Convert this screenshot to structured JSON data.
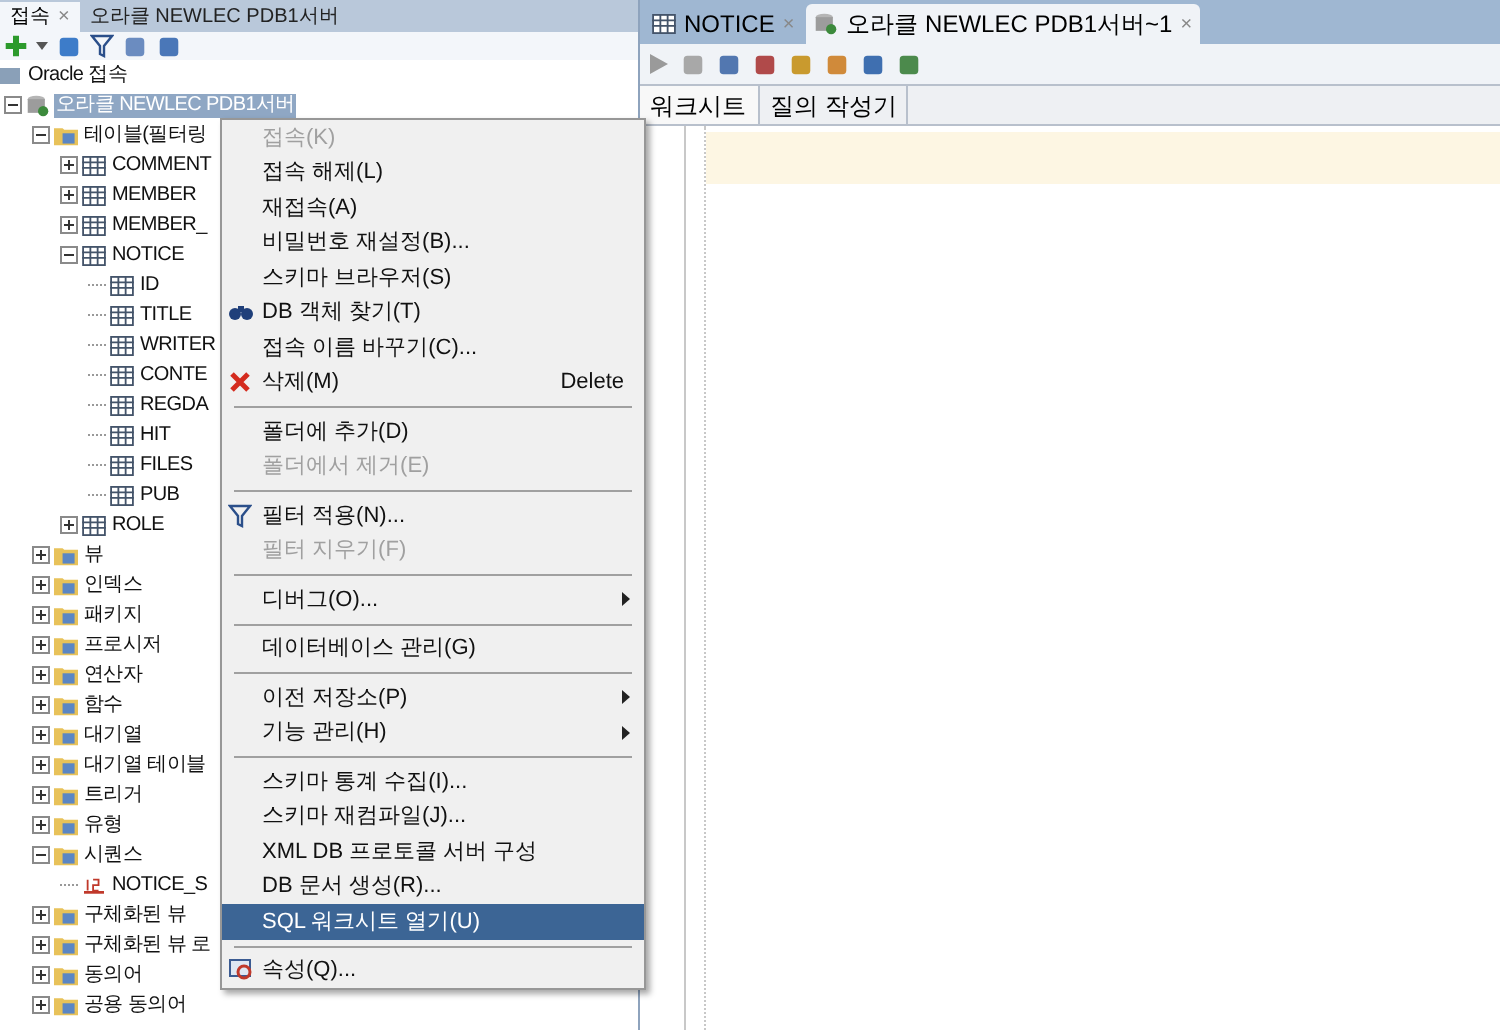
{
  "left_tabs": [
    {
      "label": "접속",
      "selected": true,
      "close": "×"
    },
    {
      "label": "오라클 NEWLEC PDB1서버",
      "selected": false
    }
  ],
  "tree": [
    {
      "label": "Oracle 접속",
      "kind": "root",
      "selected": false,
      "children": [
        {
          "label": "오라클 NEWLEC PDB1서버",
          "kind": "connection",
          "expanded": true,
          "selected": true,
          "children": [
            {
              "label": "테이블(필터링",
              "kind": "folder",
              "expanded": true,
              "selected": false,
              "children": [
                {
                  "label": "COMMENT",
                  "kind": "table",
                  "expanded": false,
                  "selected": false
                },
                {
                  "label": "MEMBER",
                  "kind": "table",
                  "expanded": false,
                  "selected": false
                },
                {
                  "label": "MEMBER_",
                  "kind": "table",
                  "expanded": false,
                  "selected": false
                },
                {
                  "label": "NOTICE",
                  "kind": "table",
                  "expanded": true,
                  "selected": false,
                  "children": [
                    {
                      "label": "ID",
                      "kind": "column",
                      "selected": false
                    },
                    {
                      "label": "TITLE",
                      "kind": "column",
                      "selected": false
                    },
                    {
                      "label": "WRITER",
                      "kind": "column",
                      "selected": false
                    },
                    {
                      "label": "CONTE",
                      "kind": "column",
                      "selected": false
                    },
                    {
                      "label": "REGDA",
                      "kind": "column",
                      "selected": false
                    },
                    {
                      "label": "HIT",
                      "kind": "column",
                      "selected": false
                    },
                    {
                      "label": "FILES",
                      "kind": "column",
                      "selected": false
                    },
                    {
                      "label": "PUB",
                      "kind": "column",
                      "selected": false
                    }
                  ]
                },
                {
                  "label": "ROLE",
                  "kind": "table",
                  "expanded": false,
                  "selected": false
                }
              ]
            },
            {
              "label": "뷰",
              "kind": "folder",
              "expanded": false,
              "selected": false
            },
            {
              "label": "인덱스",
              "kind": "folder",
              "expanded": false,
              "selected": false
            },
            {
              "label": "패키지",
              "kind": "folder",
              "expanded": false,
              "selected": false
            },
            {
              "label": "프로시저",
              "kind": "folder",
              "expanded": false,
              "selected": false
            },
            {
              "label": "연산자",
              "kind": "folder",
              "expanded": false,
              "selected": false
            },
            {
              "label": "함수",
              "kind": "folder",
              "expanded": false,
              "selected": false
            },
            {
              "label": "대기열",
              "kind": "folder",
              "expanded": false,
              "selected": false
            },
            {
              "label": "대기열 테이블",
              "kind": "folder",
              "expanded": false,
              "selected": false
            },
            {
              "label": "트리거",
              "kind": "folder",
              "expanded": false,
              "selected": false
            },
            {
              "label": "유형",
              "kind": "folder",
              "expanded": false,
              "selected": false
            },
            {
              "label": "시퀀스",
              "kind": "folder",
              "expanded": true,
              "selected": false,
              "children": [
                {
                  "label": "NOTICE_S",
                  "kind": "sequence",
                  "selected": false
                }
              ]
            },
            {
              "label": "구체화된 뷰",
              "kind": "folder",
              "expanded": false,
              "selected": false
            },
            {
              "label": "구체화된 뷰 로",
              "kind": "folder",
              "expanded": false,
              "selected": false
            },
            {
              "label": "동의어",
              "kind": "folder",
              "expanded": false,
              "selected": false
            },
            {
              "label": "공용 동의어",
              "kind": "folder",
              "expanded": false,
              "selected": false
            }
          ]
        }
      ]
    }
  ],
  "context_menu": [
    {
      "kind": "item",
      "label": "접속(K)",
      "disabled": true,
      "selected": false
    },
    {
      "kind": "item",
      "label": "접속 해제(L)",
      "disabled": false,
      "selected": false
    },
    {
      "kind": "item",
      "label": "재접속(A)",
      "disabled": false,
      "selected": false
    },
    {
      "kind": "item",
      "label": "비밀번호 재설정(B)...",
      "disabled": false,
      "selected": false
    },
    {
      "kind": "item",
      "label": "스키마 브라우저(S)",
      "disabled": false,
      "selected": false
    },
    {
      "kind": "item",
      "label": "DB 객체 찾기(T)",
      "disabled": false,
      "selected": false
    },
    {
      "kind": "item",
      "label": "접속 이름 바꾸기(C)...",
      "disabled": false,
      "selected": false
    },
    {
      "kind": "item",
      "label": "삭제(M)",
      "disabled": false,
      "selected": false,
      "shortcut": "Delete"
    },
    {
      "kind": "separator"
    },
    {
      "kind": "item",
      "label": "폴더에 추가(D)",
      "disabled": false,
      "selected": false
    },
    {
      "kind": "item",
      "label": "폴더에서 제거(E)",
      "disabled": true,
      "selected": false
    },
    {
      "kind": "separator"
    },
    {
      "kind": "item",
      "label": "필터 적용(N)...",
      "disabled": false,
      "selected": false
    },
    {
      "kind": "item",
      "label": "필터 지우기(F)",
      "disabled": true,
      "selected": false
    },
    {
      "kind": "separator"
    },
    {
      "kind": "item",
      "label": "디버그(O)...",
      "disabled": false,
      "selected": false,
      "submenu": true
    },
    {
      "kind": "separator"
    },
    {
      "kind": "item",
      "label": "데이터베이스 관리(G)",
      "disabled": false,
      "selected": false
    },
    {
      "kind": "separator"
    },
    {
      "kind": "item",
      "label": "이전 저장소(P)",
      "disabled": false,
      "selected": false,
      "submenu": true
    },
    {
      "kind": "item",
      "label": "기능 관리(H)",
      "disabled": false,
      "selected": false,
      "submenu": true
    },
    {
      "kind": "separator"
    },
    {
      "kind": "item",
      "label": "스키마 통계 수집(I)...",
      "disabled": false,
      "selected": false
    },
    {
      "kind": "item",
      "label": "스키마 재컴파일(J)...",
      "disabled": false,
      "selected": false
    },
    {
      "kind": "item",
      "label": "XML DB 프로토콜 서버 구성",
      "disabled": false,
      "selected": false
    },
    {
      "kind": "item",
      "label": "DB 문서 생성(R)...",
      "disabled": false,
      "selected": false
    },
    {
      "kind": "item",
      "label": "SQL 워크시트 열기(U)",
      "disabled": false,
      "selected": true
    },
    {
      "kind": "separator"
    },
    {
      "kind": "item",
      "label": "속성(Q)...",
      "disabled": false,
      "selected": false
    }
  ],
  "editor_tabs": [
    {
      "label": "NOTICE",
      "selected": false,
      "close": "×"
    },
    {
      "label": "오라클 NEWLEC PDB1서버~1",
      "selected": true,
      "close": "×"
    }
  ],
  "editor_subtabs": [
    {
      "label": "워크시트",
      "selected": true
    },
    {
      "label": "질의 작성기",
      "selected": false
    }
  ]
}
